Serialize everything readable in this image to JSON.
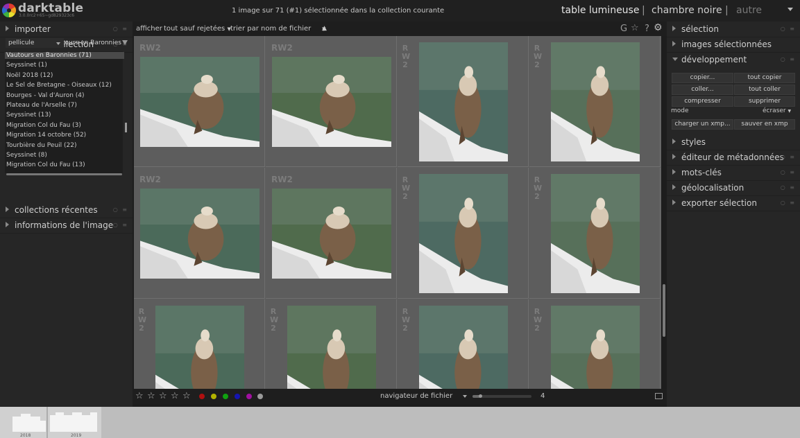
{
  "header": {
    "app_name": "darktable",
    "version": "3.0.0rc2+65~gd829323c6",
    "selection_status": "1 image sur 71 (#1) sélectionnée dans la collection courante",
    "views": {
      "lighttable": "table lumineuse",
      "separator": "|",
      "darkroom": "chambre noire",
      "other": "autre"
    }
  },
  "left_panel": {
    "import_title": "importer",
    "filters_title": "filtres de collection",
    "property_select": "pellicule",
    "collection_input": "Vautours en Baronnies",
    "collections": [
      "Vautours en Baronnies (71)",
      "Seyssinet (1)",
      "Noël 2018 (12)",
      "Le Sel de Bretagne - Oiseaux (12)",
      "Bourges - Val d'Auron (4)",
      "Plateau de l'Arselle (7)",
      "Seyssinet (13)",
      "Migration Col du Fau (3)",
      "Migration 14 octobre (52)",
      "Tourbière du Peuil (22)",
      "Seyssinet (8)",
      "Migration Col du Fau (13)"
    ],
    "recent_title": "collections récentes",
    "image_info_title": "informations de l'image"
  },
  "toolbar": {
    "show_label": "afficher",
    "rating_filter": "tout sauf rejetées",
    "sort_label": "trier par",
    "sort_value": "nom de fichier",
    "icons": [
      "grouping-icon",
      "star-overlay-icon",
      "help-icon",
      "settings-icon"
    ]
  },
  "lighttable": {
    "format_label": "RW2",
    "thumbnails": 12
  },
  "bottom_toolbar": {
    "stars": [
      "☆",
      "☆",
      "☆",
      "☆",
      "☆"
    ],
    "color_labels": [
      "#b01010",
      "#b3b300",
      "#10a010",
      "#1515b0",
      "#a010a0",
      "#9a9a9a"
    ],
    "layout": "navigateur de fichier",
    "zoom_value": "4"
  },
  "right_panel": {
    "modules": {
      "selection": "sélection",
      "selected_images": "images sélectionnées",
      "development": "développement",
      "styles": "styles",
      "metadata_editor": "éditeur de métadonnées",
      "tags": "mots-clés",
      "geolocation": "géolocalisation",
      "export": "exporter sélection"
    },
    "buttons": {
      "copy": "copier...",
      "copy_all": "tout copier",
      "paste": "coller...",
      "paste_all": "tout coller",
      "compress": "compresser",
      "delete": "supprimer",
      "mode_label": "mode",
      "mode_value": "écraser",
      "load_xmp": "charger un xmp...",
      "save_xmp": "sauver en xmp"
    }
  },
  "timeline": {
    "years": [
      "2018",
      "2019"
    ]
  },
  "colors": {
    "background": "#1d1d1d",
    "panel": "#262626",
    "lighttable": "#5d5d5d"
  }
}
